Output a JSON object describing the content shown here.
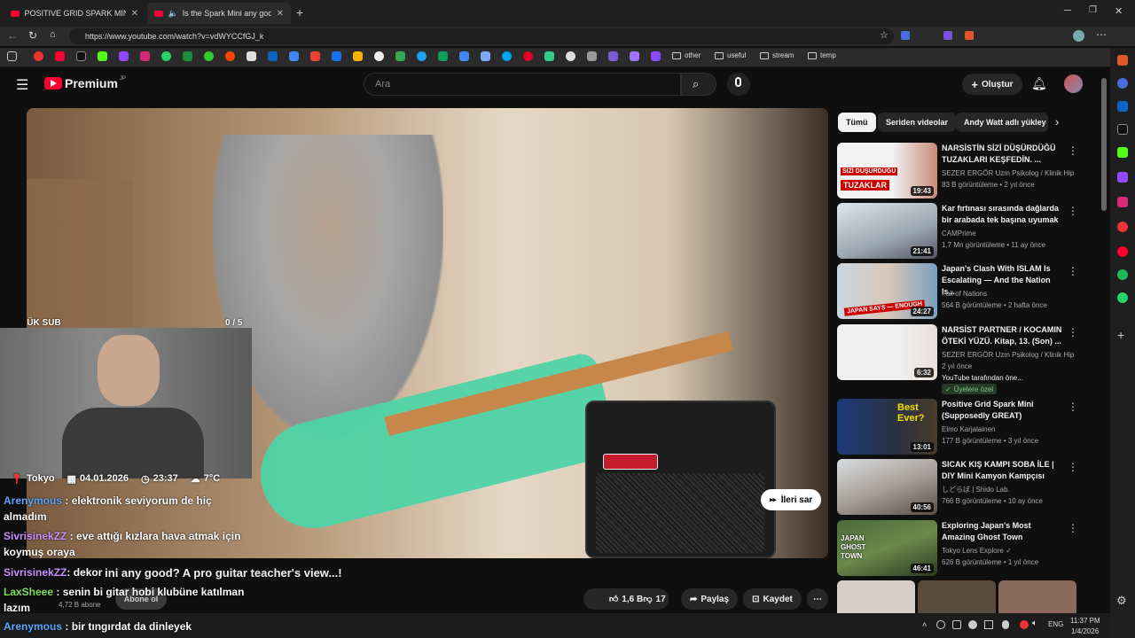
{
  "tabs": [
    {
      "title": "POSITIVE GRID SPARK MINI - Met"
    },
    {
      "title": "Is the Spark Mini any good? A"
    }
  ],
  "address": {
    "url": "https://www.youtube.com/watch?v=vdWYCCfGJ_k"
  },
  "bookmarks": {
    "folders": [
      "other",
      "useful",
      "stream",
      "temp"
    ]
  },
  "header": {
    "logo": "Premium",
    "logo_badge": "JP",
    "search_placeholder": "Ara",
    "create_label": "Oluştur"
  },
  "overlay": {
    "daily_sub_label": "GÜNLÜK SUB",
    "daily_sub_count": "0 / 5",
    "city": "Tokyo",
    "date": "04.01.2026",
    "time": "23:37",
    "temp": "7°C"
  },
  "chat": [
    {
      "user": "Arenymous",
      "text": ": elektronik seviyorum de hiç"
    },
    {
      "user": "",
      "text": "almadım"
    },
    {
      "user": "SivrisinekZZ",
      "text": ": eve attığı kızlara hava atmak için"
    },
    {
      "user": "",
      "text": "koymuş oraya"
    },
    {
      "user": "SivrisinekZZ",
      "text": ": dekor"
    },
    {
      "user": "LaxSheee",
      "text": ": senin bi gitar hobi klubüne katılman"
    },
    {
      "user": "",
      "text": "lazım"
    },
    {
      "user": "Arenymous",
      "text": ": bir tıngırdat da dinleyek"
    }
  ],
  "video": {
    "skip_label": "İleri sar",
    "title_visible": "Is the Spark Mini any good? A pro guitar teacher's view...!",
    "subs": "4,72 B abone",
    "subscribe": "Abone ol",
    "likes": "1,6 B",
    "dislikes": "17",
    "share": "Paylaş",
    "save": "Kaydet"
  },
  "chips": [
    "Tümü",
    "Seriden videolar",
    "Andy Watt adlı yükley"
  ],
  "recs": [
    {
      "title": "NARSİSTİN SİZİ DÜŞÜRDÜĞÜ TUZAKLARI KEŞFEDİN. ...",
      "channel": "SEZER ERGÖR Uzm Psikolog / Klinik Hip...",
      "meta": "83 B görüntüleme • 2 yıl önce",
      "duration": "19:43"
    },
    {
      "title": "Kar fırtınası sırasında dağlarda bir arabada tek başına uyumak",
      "channel": "CAMPrime",
      "meta": "1,7 Mn görüntüleme • 11 ay önce",
      "duration": "21:41"
    },
    {
      "title": "Japan's Clash With ISLAM Is Escalating — And the Nation Is...",
      "channel": "Fall of Nations",
      "meta": "564 B görüntüleme • 2 hafta önce",
      "duration": "24:27"
    },
    {
      "title": "NARSİST PARTNER / KOCAMIN ÖTEKİ YÜZÜ. Kitap, 13. (Son) ...",
      "channel": "SEZER ERGÖR Uzm Psikolog / Klinik Hip...",
      "meta": "2 yıl önce",
      "extra": "YouTube tarafından öne...",
      "badge": "Üyelere özel",
      "duration": "6:32"
    },
    {
      "title": "Positive Grid Spark Mini (Supposedly GREAT)",
      "channel": "Elmo Karjalainen",
      "meta": "177 B görüntüleme • 3 yıl önce",
      "duration": "13:01"
    },
    {
      "title": "SICAK KIŞ KAMPI SOBA İLE | DIY Mini Kamyon Kampçısı",
      "channel": "しどらぼ | Shido Lab.",
      "meta": "766 B görüntüleme • 10 ay önce",
      "duration": "40:56"
    },
    {
      "title": "Exploring Japan's Most Amazing Ghost Town",
      "channel": "Tokyo Lens Explore",
      "meta": "626 B görüntüleme • 1 yıl önce",
      "duration": "46:41"
    }
  ],
  "thumb_texts": {
    "t1a": "SİZİ DÜŞÜRDÜĞÜ",
    "t1b": "TUZAKLAR",
    "t3": "JAPAN SAYS — ENOUGH",
    "t5": "Best Ever?",
    "t7": "JAPAN GHOST TOWN"
  },
  "taskbar": {
    "lang": "ENG",
    "time": "11:37 PM",
    "date": "1/4/2026"
  }
}
